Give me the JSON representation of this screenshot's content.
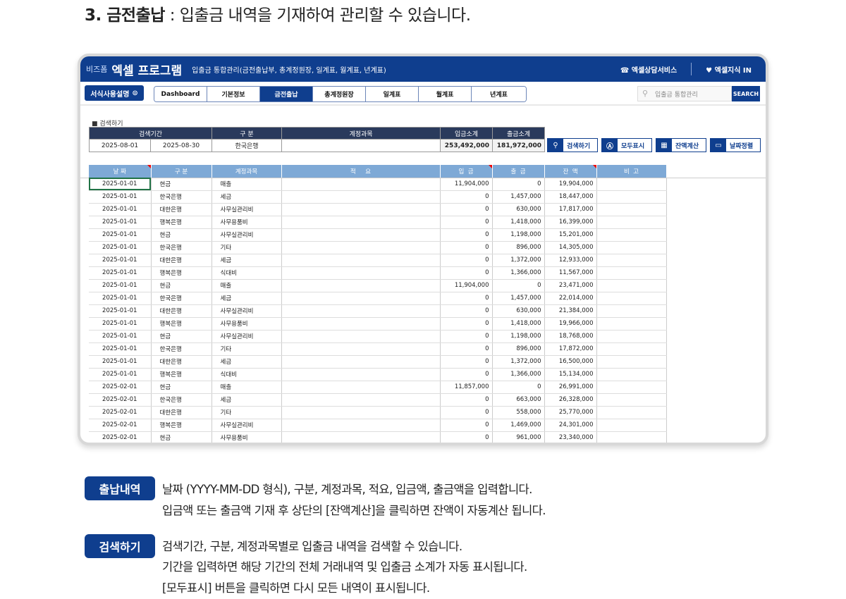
{
  "heading": {
    "number_title": "3. 금전출납",
    "description": " : 입출금 내역을 기재하여 관리할 수 있습니다."
  },
  "app": {
    "logo": "비즈폼",
    "title": "엑셀 프로그램",
    "subtitle": "입출금 통합관리(금전출납부, 총계정원장, 일계표, 월계표, 년계표)",
    "consult": "엑셀상담서비스",
    "knowledge": "엑셀지식 IN",
    "brand_color": "#0f3e8e"
  },
  "nav": {
    "guide_button": "서식사용설명",
    "tabs": [
      "Dashboard",
      "기본정보",
      "금전출납",
      "총계정원장",
      "일계표",
      "월계표",
      "년계표"
    ],
    "active_tab": "금전출납",
    "search_placeholder": "입출금 통합관리",
    "search_button": "SEARCH"
  },
  "search": {
    "section_label": "■ 검색하기",
    "headers": [
      "검색기간",
      "구 분",
      "계정과목",
      "입금소계",
      "출금소계"
    ],
    "start_date": "2025-08-01",
    "end_date": "2025-08-30",
    "category": "한국은행",
    "account": "",
    "deposit_total": "253,492,000",
    "withdraw_total": "181,972,000"
  },
  "actions": [
    "검색하기",
    "모두표시",
    "잔액계산",
    "날짜정렬"
  ],
  "table": {
    "headers": [
      "날 짜",
      "구 분",
      "계정과목",
      "적     요",
      "입  금",
      "출  금",
      "잔  액",
      "비  고"
    ],
    "rows": [
      [
        "2025-01-01",
        "현금",
        "매출",
        "",
        "11,904,000",
        "0",
        "19,904,000",
        ""
      ],
      [
        "2025-01-01",
        "한국은행",
        "세금",
        "",
        "0",
        "1,457,000",
        "18,447,000",
        ""
      ],
      [
        "2025-01-01",
        "대한은행",
        "사무실관리비",
        "",
        "0",
        "630,000",
        "17,817,000",
        ""
      ],
      [
        "2025-01-01",
        "행복은행",
        "사무용품비",
        "",
        "0",
        "1,418,000",
        "16,399,000",
        ""
      ],
      [
        "2025-01-01",
        "현금",
        "사무실관리비",
        "",
        "0",
        "1,198,000",
        "15,201,000",
        ""
      ],
      [
        "2025-01-01",
        "한국은행",
        "기타",
        "",
        "0",
        "896,000",
        "14,305,000",
        ""
      ],
      [
        "2025-01-01",
        "대한은행",
        "세금",
        "",
        "0",
        "1,372,000",
        "12,933,000",
        ""
      ],
      [
        "2025-01-01",
        "행복은행",
        "식대비",
        "",
        "0",
        "1,366,000",
        "11,567,000",
        ""
      ],
      [
        "2025-01-01",
        "현금",
        "매출",
        "",
        "11,904,000",
        "0",
        "23,471,000",
        ""
      ],
      [
        "2025-01-01",
        "한국은행",
        "세금",
        "",
        "0",
        "1,457,000",
        "22,014,000",
        ""
      ],
      [
        "2025-01-01",
        "대한은행",
        "사무실관리비",
        "",
        "0",
        "630,000",
        "21,384,000",
        ""
      ],
      [
        "2025-01-01",
        "행복은행",
        "사무용품비",
        "",
        "0",
        "1,418,000",
        "19,966,000",
        ""
      ],
      [
        "2025-01-01",
        "현금",
        "사무실관리비",
        "",
        "0",
        "1,198,000",
        "18,768,000",
        ""
      ],
      [
        "2025-01-01",
        "한국은행",
        "기타",
        "",
        "0",
        "896,000",
        "17,872,000",
        ""
      ],
      [
        "2025-01-01",
        "대한은행",
        "세금",
        "",
        "0",
        "1,372,000",
        "16,500,000",
        ""
      ],
      [
        "2025-01-01",
        "행복은행",
        "식대비",
        "",
        "0",
        "1,366,000",
        "15,134,000",
        ""
      ],
      [
        "2025-02-01",
        "현금",
        "매출",
        "",
        "11,857,000",
        "0",
        "26,991,000",
        ""
      ],
      [
        "2025-02-01",
        "한국은행",
        "세금",
        "",
        "0",
        "663,000",
        "26,328,000",
        ""
      ],
      [
        "2025-02-01",
        "대한은행",
        "기타",
        "",
        "0",
        "558,000",
        "25,770,000",
        ""
      ],
      [
        "2025-02-01",
        "행복은행",
        "사무실관리비",
        "",
        "0",
        "1,469,000",
        "24,301,000",
        ""
      ],
      [
        "2025-02-01",
        "현금",
        "사무용품비",
        "",
        "0",
        "961,000",
        "23,340,000",
        ""
      ]
    ]
  },
  "notes": [
    {
      "badge": "출납내역",
      "lines": [
        "날짜 (YYYY-MM-DD 형식), 구분, 계정과목, 적요, 입금액, 출금액을 입력합니다.",
        "입금액 또는 출금액 기재 후 상단의 [잔액계산]을 클릭하면 잔액이 자동계산 됩니다."
      ]
    },
    {
      "badge": "검색하기",
      "lines": [
        "검색기간, 구분, 계정과목별로 입출금 내역을 검색할 수 있습니다.",
        "기간을 입력하면 해당 기간의 전체 거래내역 및 입출금 소계가 자동 표시됩니다.",
        "[모두표시] 버튼을 클릭하면 다시 모든 내역이 표시됩니다."
      ]
    }
  ]
}
